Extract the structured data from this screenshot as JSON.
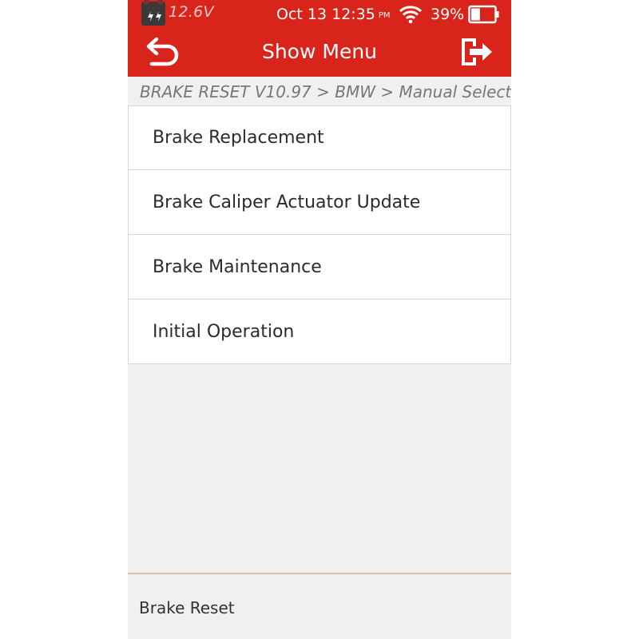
{
  "status_bar": {
    "voltage": "12.6V",
    "date_time": "Oct 13 12:35",
    "ampm": "PM",
    "battery_percent": "39%",
    "battery_level": 0.39
  },
  "header": {
    "title": "Show Menu",
    "back_icon": "back-arrow-icon",
    "exit_icon": "exit-icon",
    "color": "#d9241b"
  },
  "breadcrumb": "BRAKE RESET V10.97 > BMW > Manual Select",
  "menu": {
    "items": [
      {
        "label": "Brake Replacement"
      },
      {
        "label": "Brake Caliper Actuator Update"
      },
      {
        "label": "Brake Maintenance"
      },
      {
        "label": "Initial Operation"
      }
    ]
  },
  "footer": {
    "label": "Brake Reset"
  }
}
